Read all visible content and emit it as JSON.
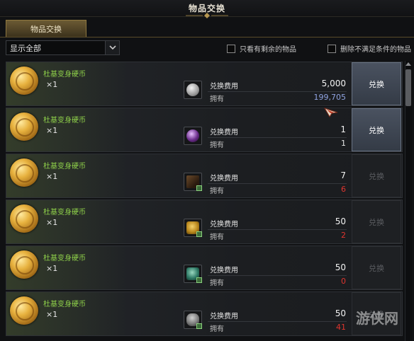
{
  "window": {
    "title": "物品交换"
  },
  "tabs": [
    {
      "label": "物品交换",
      "active": true
    }
  ],
  "filter": {
    "selected": "显示全部"
  },
  "options": [
    {
      "label": "只看有剩余的物品",
      "checked": false
    },
    {
      "label": "删除不满足条件的物品",
      "checked": false
    }
  ],
  "labels": {
    "cost": "兑换费用",
    "owned": "拥有"
  },
  "rows": [
    {
      "name": "杜基变身硬币",
      "qty": "×1",
      "cost": "5,000",
      "owned": "199,705",
      "owned_color": "#8fa3e0",
      "button": "兑换",
      "enabled": true,
      "cost_icon": "silver-coin-icon"
    },
    {
      "name": "杜基变身硬币",
      "qty": "×1",
      "cost": "1",
      "owned": "1",
      "owned_color": "#e6e6e6",
      "button": "兑换",
      "enabled": true,
      "cost_icon": "purple-gem-icon"
    },
    {
      "name": "杜基变身硬币",
      "qty": "×1",
      "cost": "7",
      "owned": "6",
      "owned_color": "#e0352f",
      "button": "兑换",
      "enabled": false,
      "cost_icon": "rune-shard-icon"
    },
    {
      "name": "杜基变身硬币",
      "qty": "×1",
      "cost": "50",
      "owned": "2",
      "owned_color": "#e0352f",
      "button": "兑换",
      "enabled": false,
      "cost_icon": "gold-ore-icon"
    },
    {
      "name": "杜基变身硬币",
      "qty": "×1",
      "cost": "50",
      "owned": "0",
      "owned_color": "#e0352f",
      "button": "兑换",
      "enabled": false,
      "cost_icon": "green-crystal-icon"
    },
    {
      "name": "杜基变身硬币",
      "qty": "×1",
      "cost": "50",
      "owned": "41",
      "owned_color": "#e0352f",
      "button": "兑换",
      "enabled": false,
      "cost_icon": "stone-ore-icon"
    }
  ],
  "watermark": "游侠网"
}
